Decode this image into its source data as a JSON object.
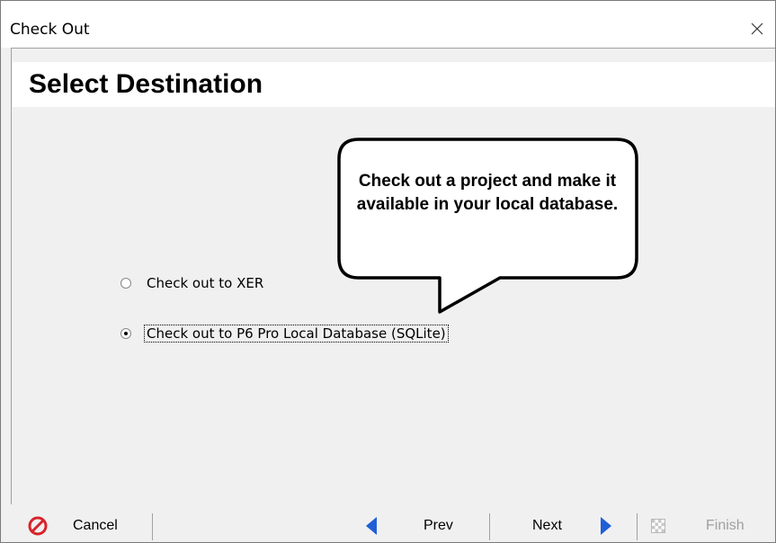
{
  "window": {
    "title": "Check Out"
  },
  "page": {
    "title": "Select Destination"
  },
  "options": [
    {
      "label": "Check out to XER",
      "selected": false
    },
    {
      "label": "Check out to P6 Pro Local Database (SQLite)",
      "selected": true
    }
  ],
  "callout": {
    "text": "Check out a project and make it available in your local database."
  },
  "buttons": {
    "cancel": "Cancel",
    "prev": "Prev",
    "next": "Next",
    "finish": "Finish"
  },
  "colors": {
    "accent_blue": "#1f5fd6",
    "cancel_red": "#d8232a",
    "disabled_text": "#a0a0a0"
  },
  "icons": {
    "close": "close-icon",
    "cancel": "cancel-icon",
    "prev": "prev-arrow-icon",
    "next": "next-arrow-icon",
    "finish": "finish-flag-icon"
  }
}
